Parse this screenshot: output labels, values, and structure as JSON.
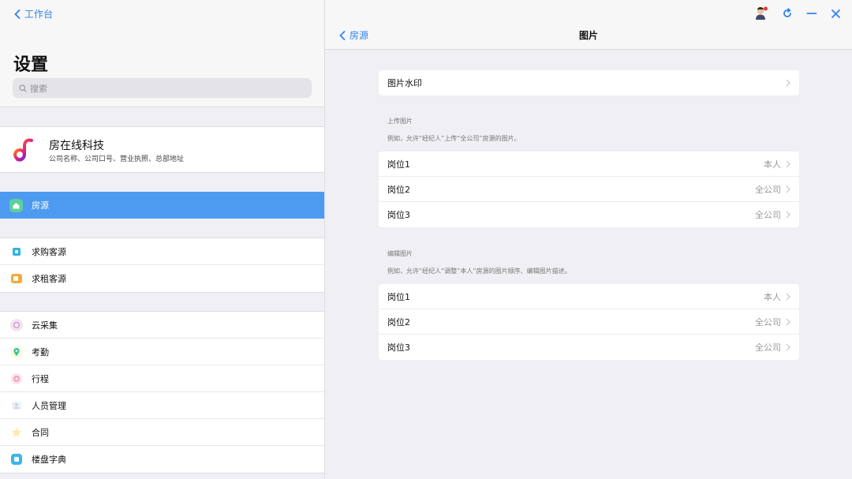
{
  "left": {
    "back_label": "工作台",
    "title": "设置",
    "search_placeholder": "搜索",
    "company": {
      "name": "房在线科技",
      "desc": "公司名称、公司口号、营业执照、总部地址"
    },
    "group1": [
      {
        "label": "房源",
        "icon": "house-icon",
        "active": true
      }
    ],
    "group2": [
      {
        "label": "求购客源",
        "icon": "buy-client-icon"
      },
      {
        "label": "求租客源",
        "icon": "rent-client-icon"
      }
    ],
    "group3": [
      {
        "label": "云采集",
        "icon": "cloud-collect-icon"
      },
      {
        "label": "考勤",
        "icon": "attendance-icon"
      },
      {
        "label": "行程",
        "icon": "schedule-icon"
      },
      {
        "label": "人员管理",
        "icon": "staff-icon"
      },
      {
        "label": "合同",
        "icon": "contract-icon"
      },
      {
        "label": "楼盘字典",
        "icon": "building-dict-icon"
      }
    ]
  },
  "right": {
    "back_label": "房源",
    "title": "图片",
    "watermark_label": "图片水印",
    "upload": {
      "title": "上传图片",
      "desc": "例如，允许“经纪人”上传“全公司”房源的图片。",
      "rows": [
        {
          "label": "岗位1",
          "value": "本人"
        },
        {
          "label": "岗位2",
          "value": "全公司"
        },
        {
          "label": "岗位3",
          "value": "全公司"
        }
      ]
    },
    "edit": {
      "title": "编辑图片",
      "desc": "例如，允许“经纪人”调整“本人”房源的图片顺序、编辑图片描述。",
      "rows": [
        {
          "label": "岗位1",
          "value": "本人"
        },
        {
          "label": "岗位2",
          "value": "全公司"
        },
        {
          "label": "岗位3",
          "value": "全公司"
        }
      ]
    }
  },
  "colors": {
    "accent": "#2f7ff5",
    "active_row": "#4d9bf0",
    "background": "#efeff4"
  }
}
